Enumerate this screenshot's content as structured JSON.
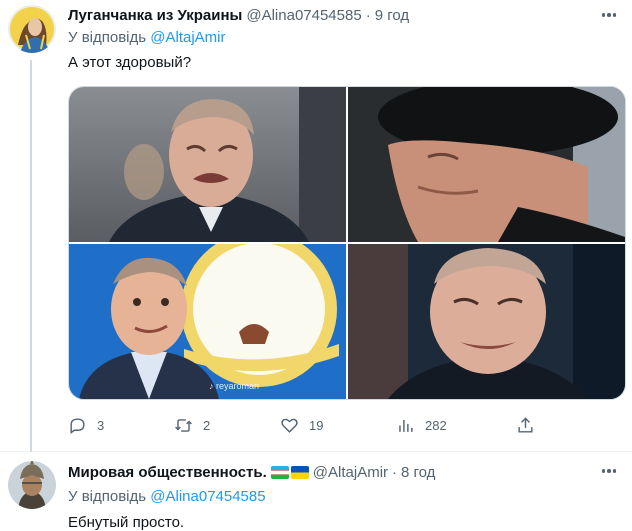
{
  "colors": {
    "accent": "#1d9bf0",
    "text_primary": "#0f1419",
    "text_secondary": "#536471",
    "divider": "#cfd9de"
  },
  "tweets": [
    {
      "display_name": "Луганчанка из Украины",
      "handle": "@Alina07454585",
      "separator": "·",
      "time": "9 год",
      "reply_prefix": "У відповідь",
      "reply_to": "@AltajAmir",
      "text": "А этот здоровый?",
      "media": {
        "photo_count": 4,
        "watermark": "♪ reyaroman"
      },
      "actions": {
        "replies": "3",
        "retweets": "2",
        "likes": "19",
        "views": "282"
      }
    },
    {
      "display_name": "Мировая общественность.",
      "flags": [
        "uzbekistan-flag",
        "ukraine-flag"
      ],
      "handle": "@AltajAmir",
      "separator": "·",
      "time": "8 год",
      "reply_prefix": "У відповідь",
      "reply_to": "@Alina07454585",
      "text": "Ебнутый просто."
    }
  ]
}
